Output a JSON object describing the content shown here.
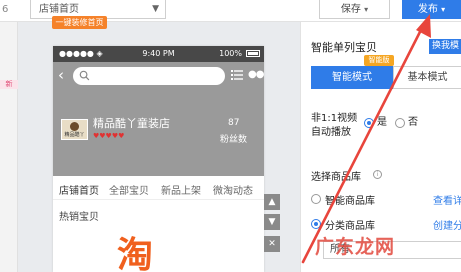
{
  "topbar": {
    "left_stub": "6",
    "page_select": "店铺首页",
    "home_tag": "一键装修首页",
    "save_label": "保存",
    "publish_label": "发布"
  },
  "left_strip": {
    "badge": "新"
  },
  "phone": {
    "status": {
      "signal": "●●●●● ◈",
      "time": "9:40 PM",
      "battery": "100%"
    },
    "shop": {
      "logo_text": "精品酷丫",
      "name": "精品酷丫童装店",
      "hearts": "♥♥♥♥♥",
      "fans_count": "87",
      "fans_label": "粉丝数"
    },
    "tabs": [
      "店铺首页",
      "全部宝贝",
      "新品上架",
      "微淘动态"
    ],
    "hot_label": "热销宝贝",
    "banner_logo": "淘"
  },
  "side_controls": {
    "up": "▲",
    "down": "▼",
    "close": "✕"
  },
  "panel": {
    "title": "智能单列宝贝",
    "change_template": "换我模板",
    "smart_badge": "智能版",
    "mode_smart": "智能模式",
    "mode_basic": "基本模式",
    "auto_play_label": "非1:1视频自动播放",
    "radio_yes": "是",
    "radio_no": "否",
    "auto_play_value": "是",
    "lib_label": "选择商品库",
    "option_smart_lib": "智能商品库",
    "link_view": "查看详",
    "option_category_lib": "分类商品库",
    "link_create": "创建分",
    "selected_lib": "分类商品库",
    "select_value": "所有"
  },
  "watermark": "广东龙网",
  "colors": {
    "accent": "#2f7ce8",
    "orange": "#f5822a",
    "arrow": "#e8453c"
  }
}
